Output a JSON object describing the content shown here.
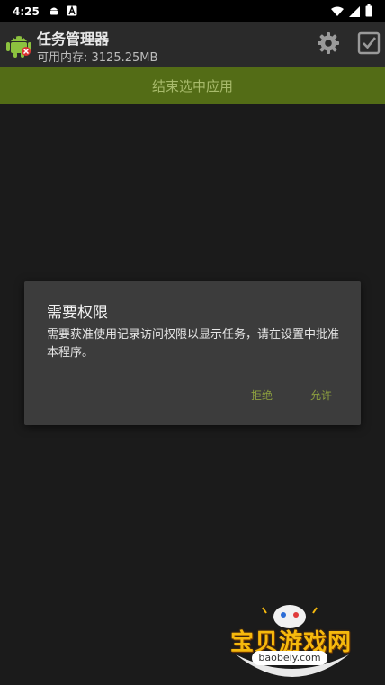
{
  "status_bar": {
    "time": "4:25",
    "icons": [
      "android-notification-icon",
      "a-notification-icon",
      "wifi-icon",
      "signal-icon",
      "battery-icon"
    ]
  },
  "app_bar": {
    "title": "任务管理器",
    "subtitle": "可用内存: 3125.25MB",
    "actions": [
      "gear-icon",
      "checkbox-icon"
    ]
  },
  "kill_button": {
    "label": "结束选中应用"
  },
  "dialog": {
    "title": "需要权限",
    "message": "需要获准使用记录访问权限以显示任务，请在设置中批准本程序。",
    "deny_label": "拒绝",
    "allow_label": "允许"
  },
  "watermark": {
    "text": "宝贝游戏网",
    "url": "baobeiy.com"
  },
  "colors": {
    "accent": "#536c16",
    "dialog_button": "#8da03f",
    "background": "#1b1b1b"
  }
}
